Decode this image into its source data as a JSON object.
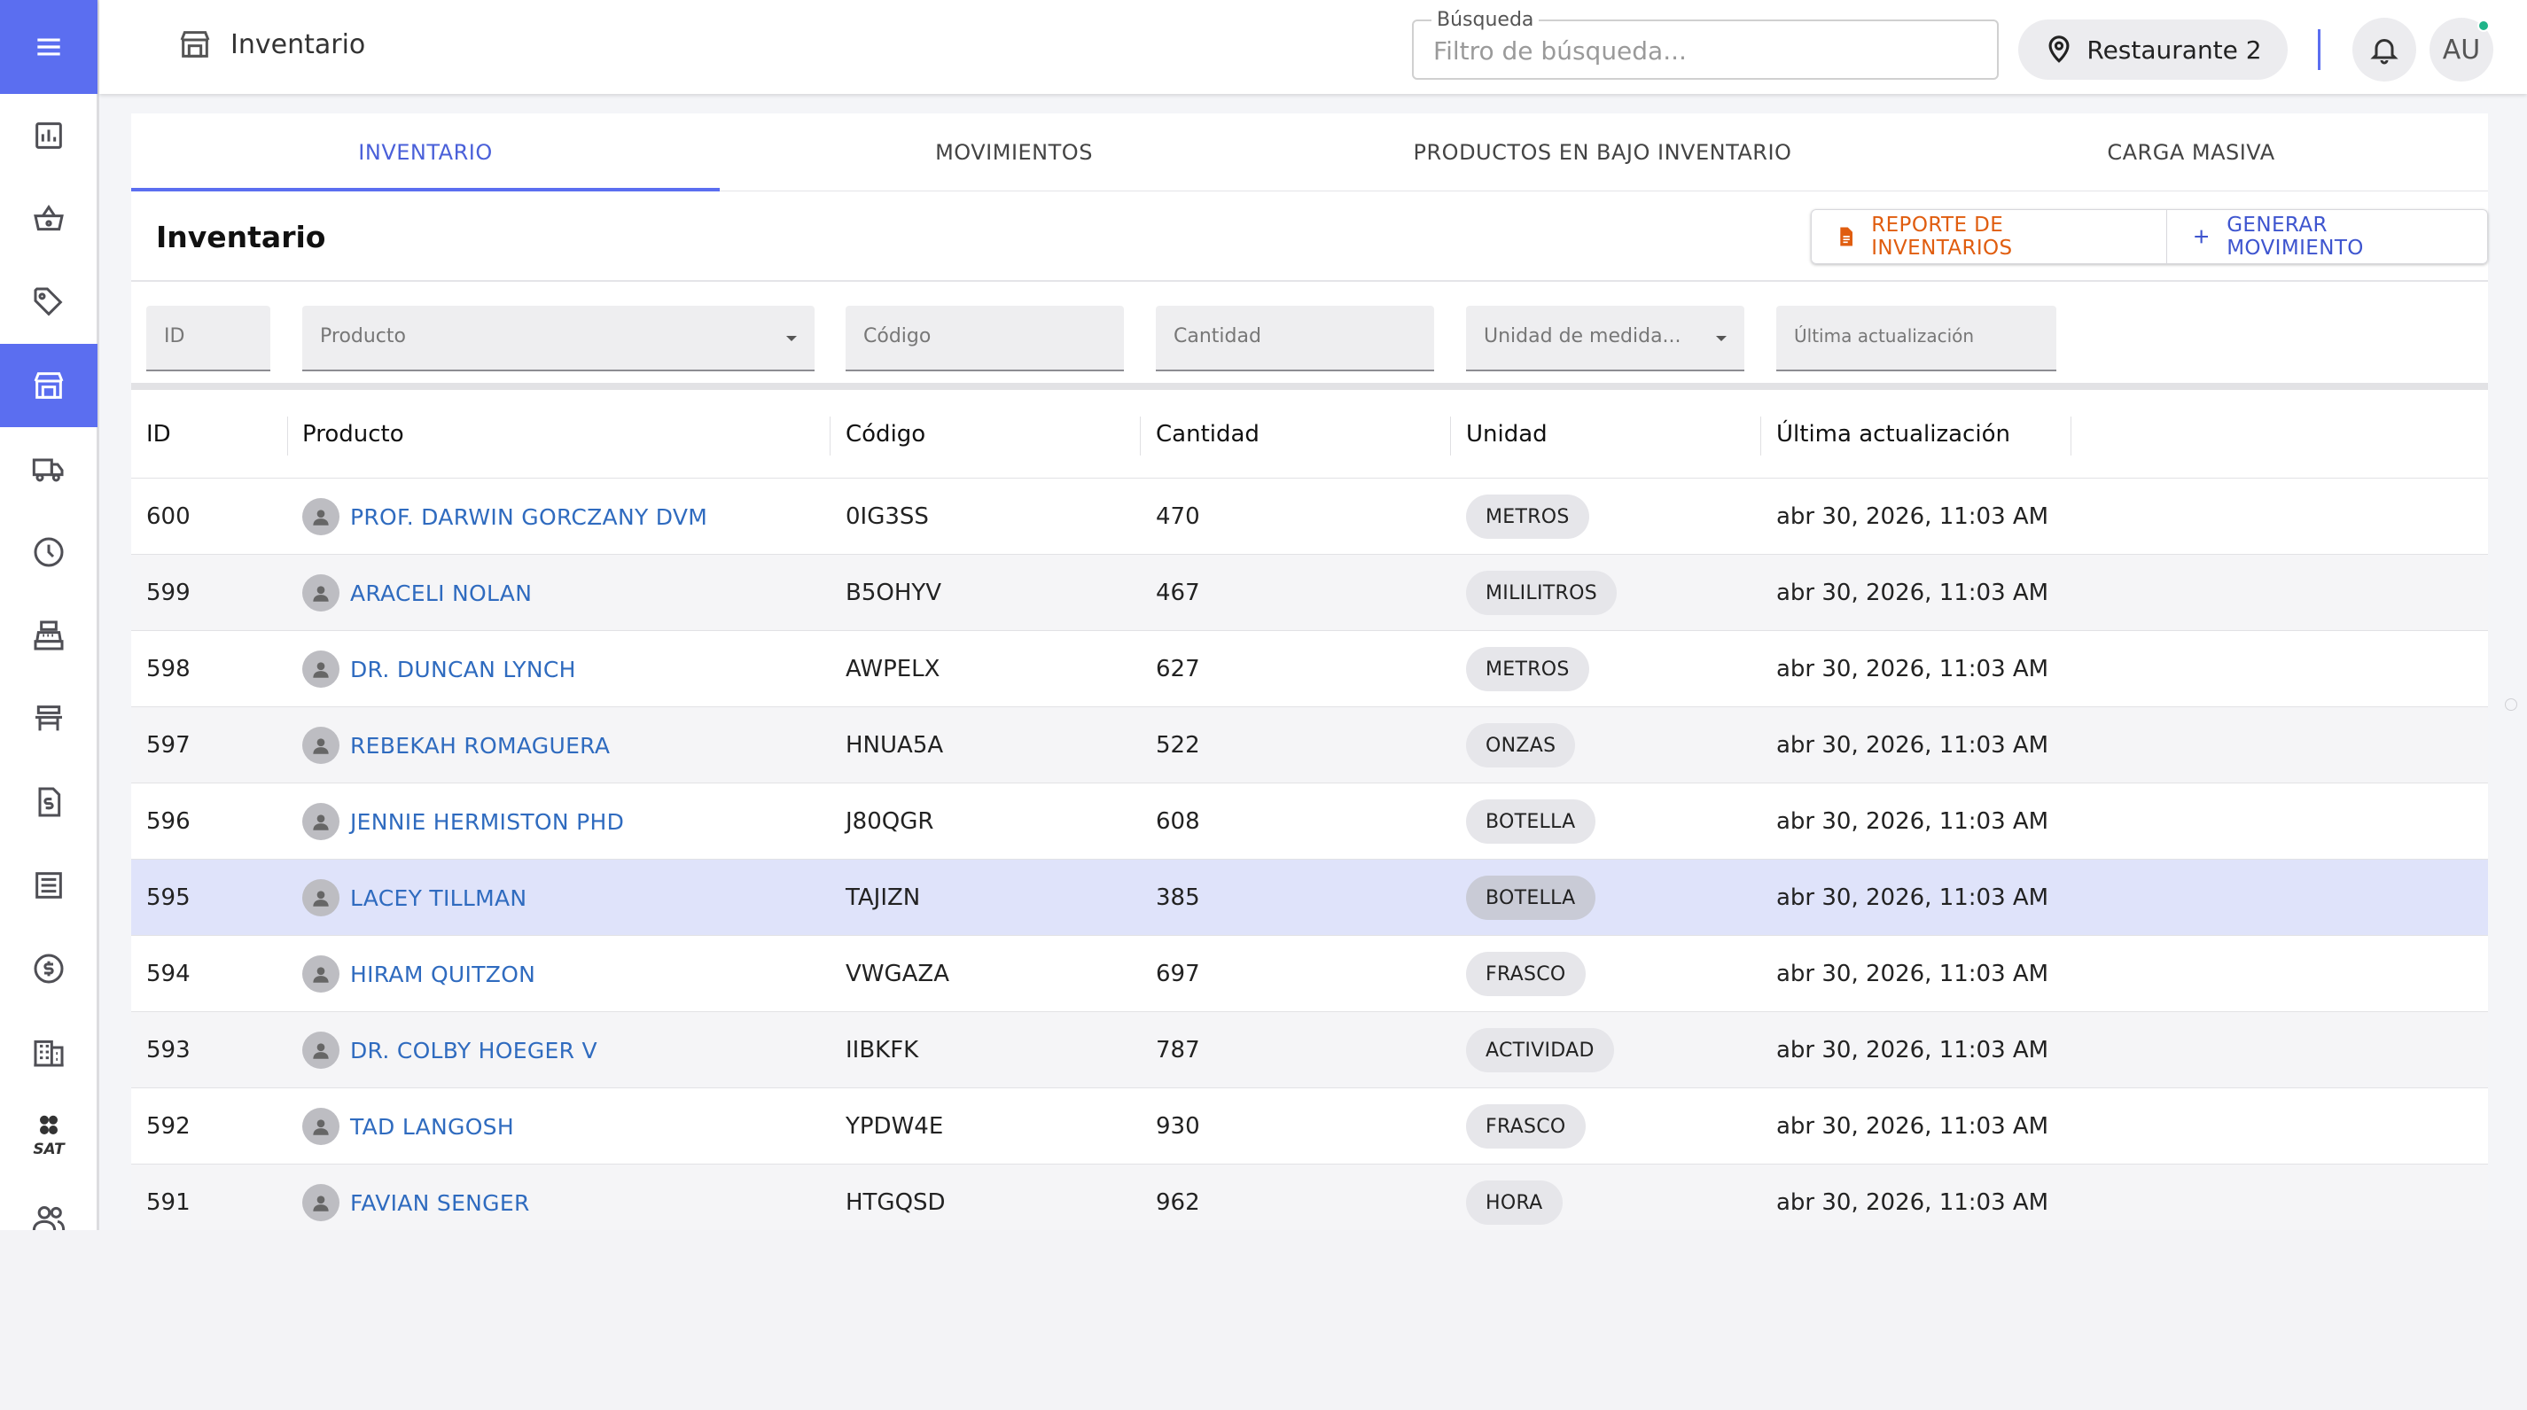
{
  "header": {
    "page_title": "Inventario",
    "search_label": "Búsqueda",
    "search_placeholder": "Filtro de búsqueda...",
    "restaurant": "Restaurante 2",
    "user_initials": "AU"
  },
  "sidebar": {
    "items": [
      {
        "icon": "reports-icon"
      },
      {
        "icon": "basket-icon"
      },
      {
        "icon": "tag-icon"
      },
      {
        "icon": "store-icon",
        "active": true
      },
      {
        "icon": "truck-icon"
      },
      {
        "icon": "clock-icon"
      },
      {
        "icon": "cash-register-icon"
      },
      {
        "icon": "table-icon"
      },
      {
        "icon": "invoice-icon"
      },
      {
        "icon": "list-icon"
      },
      {
        "icon": "dollar-icon"
      },
      {
        "icon": "building-icon"
      },
      {
        "icon": "sat-icon",
        "label": "SAT"
      },
      {
        "icon": "users-icon"
      }
    ]
  },
  "tabs": [
    {
      "label": "INVENTARIO",
      "active": true
    },
    {
      "label": "MOVIMIENTOS"
    },
    {
      "label": "PRODUCTOS EN BAJO INVENTARIO"
    },
    {
      "label": "CARGA MASIVA"
    }
  ],
  "card": {
    "title": "Inventario",
    "report_button": "REPORTE DE INVENTARIOS",
    "generate_button": "GENERAR MOVIMIENTO"
  },
  "filters": {
    "id": "ID",
    "producto": "Producto",
    "codigo": "Código",
    "cantidad": "Cantidad",
    "unidad": "Unidad de medida...",
    "actualizacion": "Última actualización"
  },
  "table": {
    "columns": [
      "ID",
      "Producto",
      "Código",
      "Cantidad",
      "Unidad",
      "Última actualización"
    ],
    "rows": [
      {
        "id": "600",
        "producto": "PROF. DARWIN GORCZANY DVM",
        "codigo": "0IG3SS",
        "cantidad": "470",
        "unidad": "METROS",
        "actualizacion": "abr 30, 2026, 11:03 AM"
      },
      {
        "id": "599",
        "producto": "ARACELI NOLAN",
        "codigo": "B5OHYV",
        "cantidad": "467",
        "unidad": "MILILITROS",
        "actualizacion": "abr 30, 2026, 11:03 AM"
      },
      {
        "id": "598",
        "producto": "DR. DUNCAN LYNCH",
        "codigo": "AWPELX",
        "cantidad": "627",
        "unidad": "METROS",
        "actualizacion": "abr 30, 2026, 11:03 AM"
      },
      {
        "id": "597",
        "producto": "REBEKAH ROMAGUERA",
        "codigo": "HNUA5A",
        "cantidad": "522",
        "unidad": "ONZAS",
        "actualizacion": "abr 30, 2026, 11:03 AM"
      },
      {
        "id": "596",
        "producto": "JENNIE HERMISTON PHD",
        "codigo": "J80QGR",
        "cantidad": "608",
        "unidad": "BOTELLA",
        "actualizacion": "abr 30, 2026, 11:03 AM"
      },
      {
        "id": "595",
        "producto": "LACEY TILLMAN",
        "codigo": "TAJIZN",
        "cantidad": "385",
        "unidad": "BOTELLA",
        "actualizacion": "abr 30, 2026, 11:03 AM",
        "selected": true
      },
      {
        "id": "594",
        "producto": "HIRAM QUITZON",
        "codigo": "VWGAZA",
        "cantidad": "697",
        "unidad": "FRASCO",
        "actualizacion": "abr 30, 2026, 11:03 AM"
      },
      {
        "id": "593",
        "producto": "DR. COLBY HOEGER V",
        "codigo": "IIBKFK",
        "cantidad": "787",
        "unidad": "ACTIVIDAD",
        "actualizacion": "abr 30, 2026, 11:03 AM"
      },
      {
        "id": "592",
        "producto": "TAD LANGOSH",
        "codigo": "YPDW4E",
        "cantidad": "930",
        "unidad": "FRASCO",
        "actualizacion": "abr 30, 2026, 11:03 AM"
      },
      {
        "id": "591",
        "producto": "FAVIAN SENGER",
        "codigo": "HTGQSD",
        "cantidad": "962",
        "unidad": "HORA",
        "actualizacion": "abr 30, 2026, 11:03 AM"
      }
    ]
  },
  "colors": {
    "accent": "#5b6ef0",
    "link": "#2f6bbf",
    "report": "#e05d0f",
    "online": "#1fb489"
  }
}
